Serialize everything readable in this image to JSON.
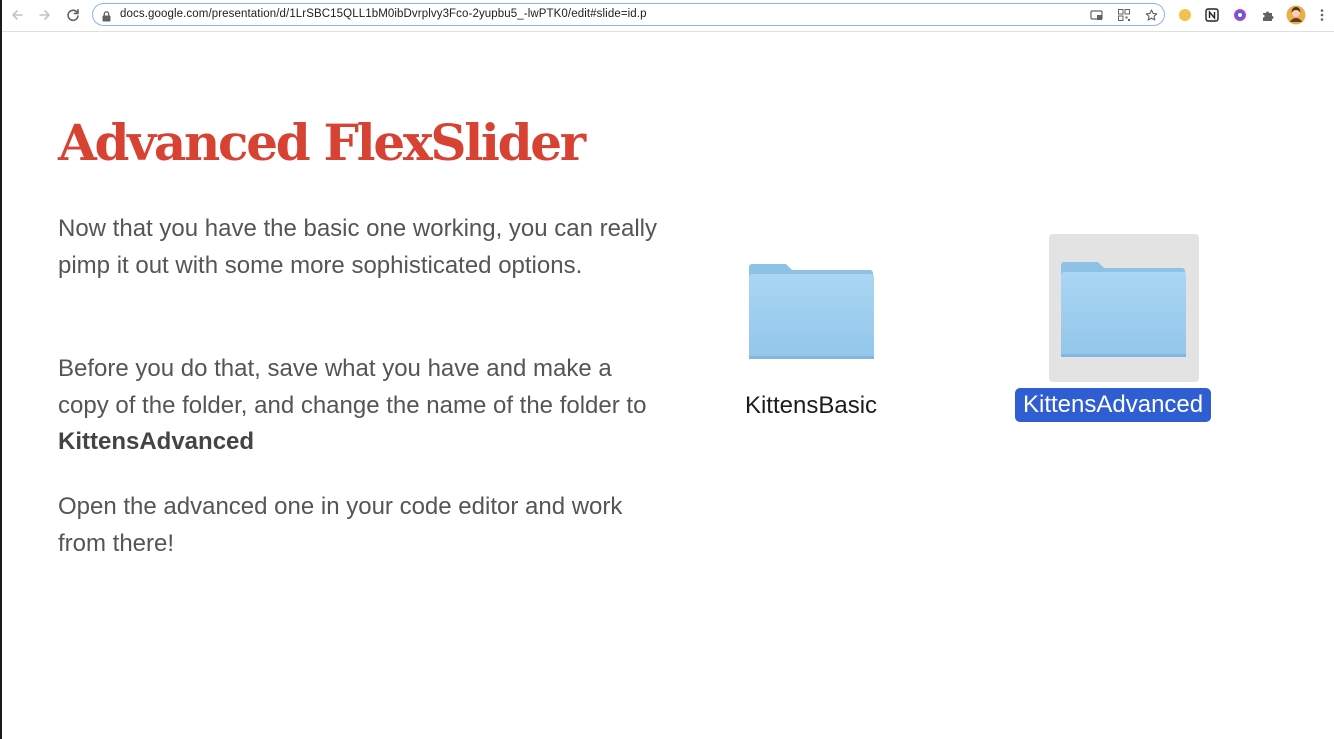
{
  "browser": {
    "url": "docs.google.com/presentation/d/1LrSBC15QLL1bM0ibDvrplvy3Fco-2yupbu5_-lwPTK0/edit#slide=id.p",
    "icons": {
      "back": "back-arrow-icon",
      "forward": "forward-arrow-icon",
      "reload": "reload-icon",
      "lock": "lock-icon",
      "cast": "cast-icon",
      "qr": "qr-code-icon",
      "bookmark": "star-icon",
      "extensions": [
        "yellow-circle-extension-icon",
        "notion-extension-icon",
        "color-ring-extension-icon",
        "puzzle-extensions-icon"
      ],
      "profile": "profile-avatar",
      "menu": "kebab-menu-icon"
    }
  },
  "slide": {
    "title": "Advanced FlexSlider",
    "title_color": "#d74232",
    "paragraph1": "Now that you have the basic one working, you can really pimp it out with some more sophisticated options.",
    "paragraph2_text": "Before you do that, save what you have and make a copy of the folder, and change the name of the folder to ",
    "paragraph2_bold": "KittensAdvanced",
    "paragraph3": "Open the advanced one in your code editor and work from there!",
    "folders": [
      {
        "label": "KittensBasic",
        "selected": false
      },
      {
        "label": "KittensAdvanced",
        "selected": true
      }
    ],
    "selection_color": "#2f5ed2",
    "folder_color": "#a5d3f0"
  }
}
